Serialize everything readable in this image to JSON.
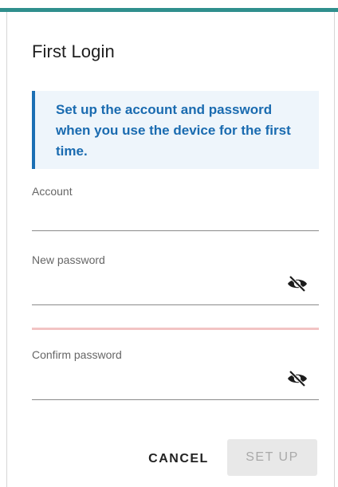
{
  "dialog": {
    "title": "First Login",
    "accent_color": "#2f8f8d",
    "info_color": "#1a6bb0",
    "info": "Set up the account and password when you use the device for the first time."
  },
  "fields": {
    "account": {
      "label": "Account",
      "value": ""
    },
    "new_password": {
      "label": "New password",
      "value": "",
      "toggle_icon": "eye-off-icon"
    },
    "confirm_password": {
      "label": "Confirm password",
      "value": "",
      "toggle_icon": "eye-off-icon"
    }
  },
  "actions": {
    "cancel_label": "CANCEL",
    "setup_label": "SET UP",
    "setup_disabled": true
  }
}
